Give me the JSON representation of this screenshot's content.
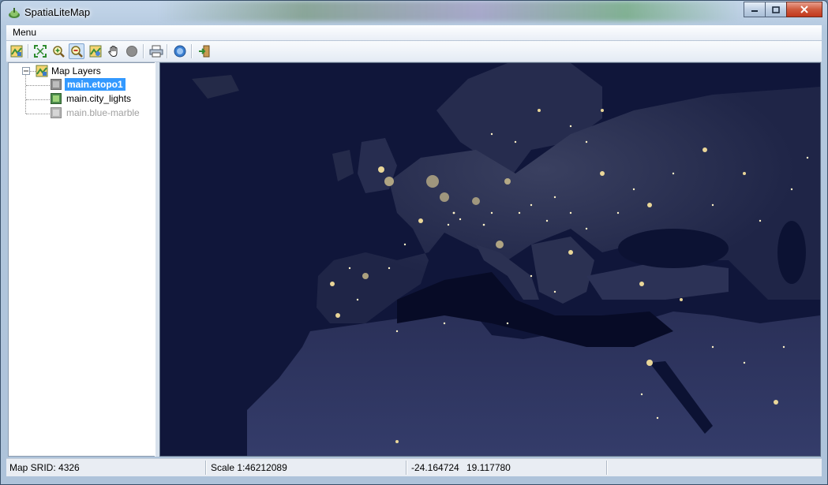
{
  "window": {
    "title": "SpatiaLiteMap",
    "icon": "app-globe-icon"
  },
  "menubar": {
    "menu_label": "Menu"
  },
  "toolbar": {
    "buttons": [
      {
        "name": "layers-tool-button",
        "icon": "map-layers-icon"
      },
      {
        "name": "zoom-full-button",
        "icon": "zoom-extent-icon"
      },
      {
        "name": "zoom-in-button",
        "icon": "zoom-in-icon"
      },
      {
        "name": "zoom-out-button",
        "icon": "zoom-out-icon",
        "active": true
      },
      {
        "name": "identify-button",
        "icon": "identify-icon"
      },
      {
        "name": "pan-button",
        "icon": "hand-icon"
      },
      {
        "name": "stop-button",
        "icon": "stop-icon"
      },
      {
        "name": "print-button",
        "icon": "printer-icon"
      },
      {
        "name": "about-button",
        "icon": "help-icon"
      },
      {
        "name": "exit-button",
        "icon": "exit-icon"
      }
    ]
  },
  "tree": {
    "root_label": "Map Layers",
    "layers": [
      {
        "label": "main.etopo1",
        "selected": true,
        "enabled": true
      },
      {
        "label": "main.city_lights",
        "selected": false,
        "enabled": true
      },
      {
        "label": "main.blue-marble",
        "selected": false,
        "enabled": false
      }
    ]
  },
  "statusbar": {
    "srid": "Map SRID: 4326",
    "scale": "Scale 1:46212089",
    "coord_x": "-24.164724",
    "coord_y": "19.117780"
  },
  "colors": {
    "selection": "#3399ff",
    "map_background": "#131a3a",
    "city_lights": "#ffe9a0"
  }
}
